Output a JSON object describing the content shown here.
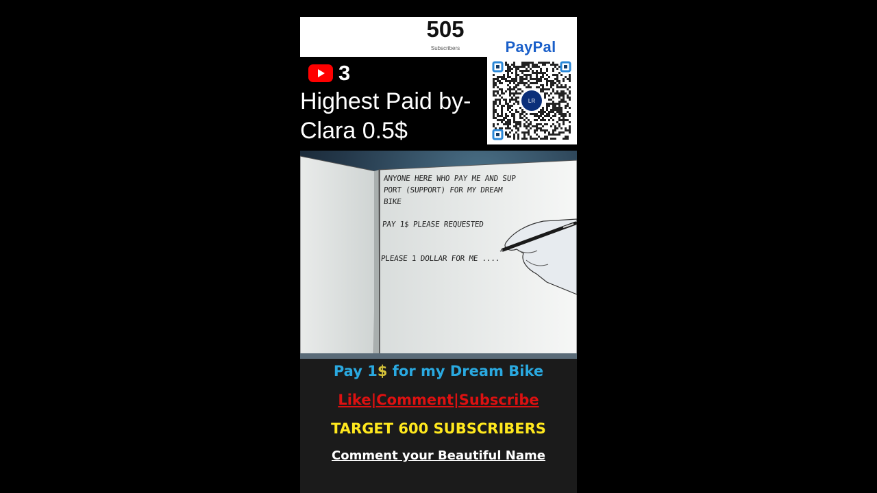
{
  "subscribers": {
    "count": "505",
    "label": "Subscribers"
  },
  "channel": {
    "video_count": "3"
  },
  "highest_paid": {
    "line1": "Highest Paid by-",
    "line2": "Clara 0.5$"
  },
  "paypal": {
    "title": "PayPal",
    "qr_center": "LR"
  },
  "note": {
    "line1": "ANYONE HERE WHO PAY ME AND SUP",
    "line2": "PORT   (SUPPORT) FOR MY DREAM",
    "line3": "BIKE",
    "line4": "PAY 1$ PLEASE REQUESTED",
    "line5": "PLEASE 1 DOLLAR FOR ME ...."
  },
  "footer": {
    "pay_prefix": "Pay 1",
    "pay_dollar": "$",
    "pay_suffix": " for my Dream Bike",
    "like_line": "Like|Comment|Subscribe",
    "target": "TARGET 600 SUBSCRIBERS",
    "comment": "Comment your Beautiful Name"
  },
  "colors": {
    "youtube_red": "#ff0000",
    "paypal_blue": "#1a5fc9",
    "pay_line": "#2aa9e0",
    "like_line": "#dd1111",
    "target_line": "#ffe81e"
  }
}
